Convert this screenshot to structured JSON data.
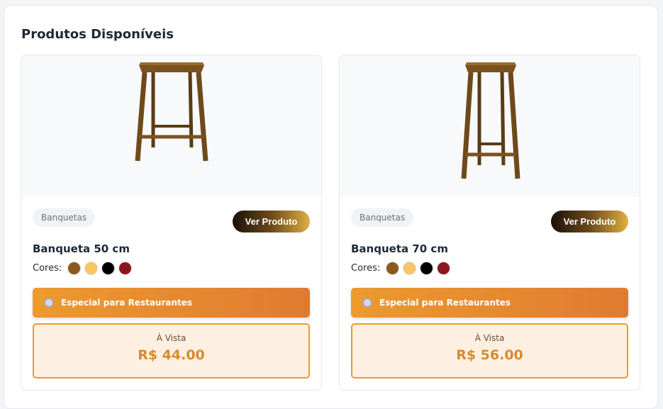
{
  "page": {
    "title": "Produtos Disponíveis"
  },
  "products": [
    {
      "category": "Banquetas",
      "button": "Ver Produto",
      "name": "Banqueta 50 cm",
      "colors_label": "Cores:",
      "colors": [
        "#8B5A1E",
        "#F7C663",
        "#000000",
        "#8E1420"
      ],
      "special": "Especial para Restaurantes",
      "price_label": "À Vista",
      "price": "R$ 44.00"
    },
    {
      "category": "Banquetas",
      "button": "Ver Produto",
      "name": "Banqueta 70 cm",
      "colors_label": "Cores:",
      "colors": [
        "#8B5A1E",
        "#F7C663",
        "#000000",
        "#8E1420"
      ],
      "special": "Especial para Restaurantes",
      "price_label": "À Vista",
      "price": "R$ 56.00"
    }
  ]
}
